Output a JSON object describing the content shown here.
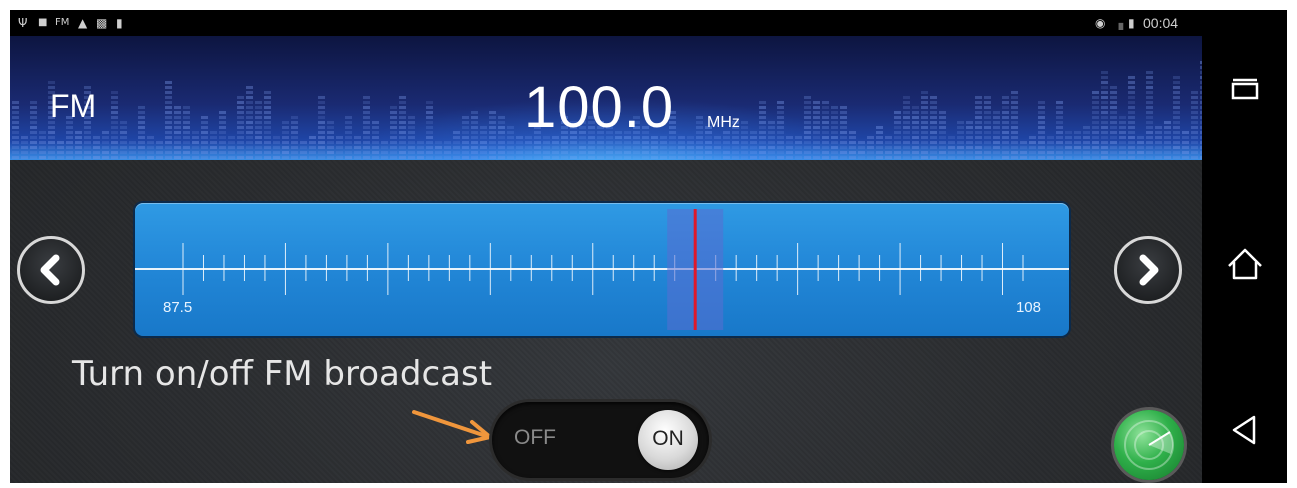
{
  "status_bar": {
    "left_icons": [
      "usb-icon",
      "lock-icon",
      "fm-icon",
      "warning-icon",
      "image-icon",
      "sd-icon"
    ],
    "fm_text": "FM",
    "time": "00:04",
    "right_icons": [
      "location-icon",
      "signal-icon",
      "battery-icon"
    ]
  },
  "header": {
    "band": "FM",
    "frequency": "100.0",
    "unit": "MHz"
  },
  "tuner": {
    "min_label": "87.5",
    "max_label": "108",
    "min_value": 87.5,
    "max_value": 108,
    "current_value": 100.0
  },
  "controls": {
    "prev_icon": "chevron-left-icon",
    "next_icon": "chevron-right-icon",
    "toggle_off_label": "OFF",
    "toggle_on_label": "ON",
    "toggle_state": "on",
    "scan_icon": "radar-icon"
  },
  "annotation": {
    "caption": "Turn on/off FM broadcast",
    "arrow_color": "#f0963c"
  },
  "nav_bar": {
    "buttons": [
      "recent-apps-icon",
      "home-icon",
      "back-icon"
    ]
  },
  "colors": {
    "tuner_blue": "#2388d8",
    "needle_red": "#e0182a",
    "radar_green": "#2fb04a"
  }
}
